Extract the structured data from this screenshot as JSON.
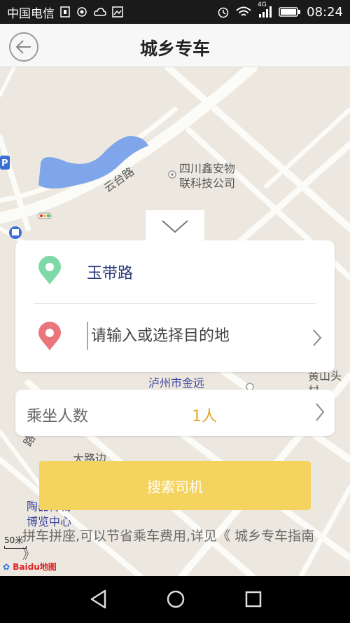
{
  "status_bar": {
    "carrier": "中国电信",
    "network": "4G",
    "time": "08:24",
    "icons": [
      "sim-icon",
      "hotspot-icon",
      "cloud-icon",
      "image-icon",
      "alarm-icon",
      "wifi-icon",
      "signal-icon",
      "battery-icon"
    ]
  },
  "header": {
    "title": "城乡专车",
    "back_icon": "back-arrow-icon"
  },
  "map": {
    "labels": {
      "road_yuntai": "云台路",
      "poi_line1": "四川鑫安物",
      "poi_line2": "联科技公司",
      "luzhou": "泸州市金远",
      "huangshan": "黄山头村",
      "dalubian": "大路边",
      "tao_line1": "陶器博物",
      "tao_line2": "博览中心",
      "road_lu": "路"
    },
    "scale": "50米",
    "logo": "Baidu地图",
    "colors": {
      "water": "#7fa5ea",
      "road": "#fbfbf7",
      "land": "#ede8df"
    }
  },
  "trip": {
    "start": "玉带路",
    "destination_placeholder": "请输入或选择目的地",
    "start_pin_color": "#7dd9a8",
    "dest_pin_color": "#e8767a"
  },
  "passengers": {
    "label": "乘坐人数",
    "value": "1人"
  },
  "actions": {
    "search": "搜索司机"
  },
  "note": "拼车拼座,可以节省乘车费用,详见《 城乡专车指南 》"
}
